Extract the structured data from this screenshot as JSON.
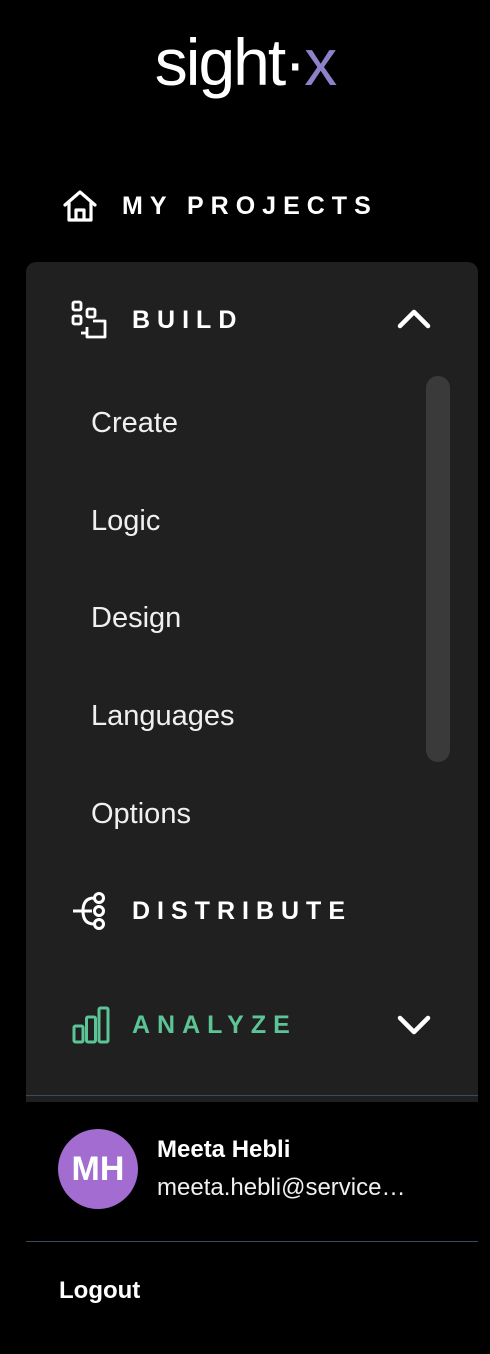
{
  "logo": {
    "main": "sight",
    "accent": "x",
    "dot": "·",
    "accent_color": "#8b82c9"
  },
  "nav": {
    "my_projects": {
      "label": "MY PROJECTS",
      "icon": "home-icon"
    },
    "build": {
      "label": "BUILD",
      "icon": "build-blocks-icon",
      "expanded": true,
      "items": [
        "Create",
        "Logic",
        "Design",
        "Languages",
        "Options"
      ]
    },
    "distribute": {
      "label": "DISTRIBUTE",
      "icon": "distribute-icon"
    },
    "analyze": {
      "label": "ANALYZE",
      "icon": "bar-chart-icon",
      "color": "#5cc496",
      "expanded": false
    }
  },
  "user": {
    "initials": "MH",
    "name": "Meeta Hebli",
    "email": "meeta.hebli@service…",
    "avatar_color": "#a26cd0"
  },
  "logout_label": "Logout"
}
